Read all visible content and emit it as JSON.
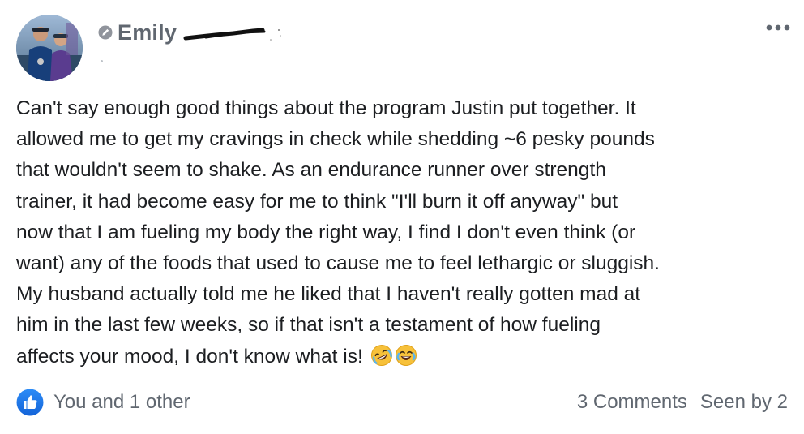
{
  "post": {
    "author": {
      "name": "Emily",
      "badge_icon": "admin-moderator-icon"
    },
    "menu_icon": "more-options-icon",
    "body_lines": [
      "Can't say enough good things about the program Justin put together. It",
      "allowed me to get my cravings in check while shedding ~6 pesky pounds",
      "that wouldn't seem to shake. As an endurance runner over strength",
      "trainer, it had become easy for me to think \"I'll burn it off anyway\" but",
      "now that I am fueling my body the right way, I find I don't even think (or",
      "want) any of the foods that used to cause me to feel lethargic or sluggish.",
      "My husband actually told me he liked that I haven't really gotten mad at",
      "him in the last few weeks, so if that isn't a testament of how fueling",
      "affects your mood, I don't know what is!"
    ],
    "emojis": [
      "rolling-on-floor-laughing",
      "face-with-tears-of-joy"
    ],
    "footer": {
      "reaction_icon": "like-icon",
      "reactions_label": "You and 1 other",
      "comments_label": "3 Comments",
      "seen_by_label": "Seen by 2"
    }
  },
  "colors": {
    "text_primary": "#1c1e21",
    "text_secondary": "#606770",
    "like_blue": "#1877f2"
  }
}
